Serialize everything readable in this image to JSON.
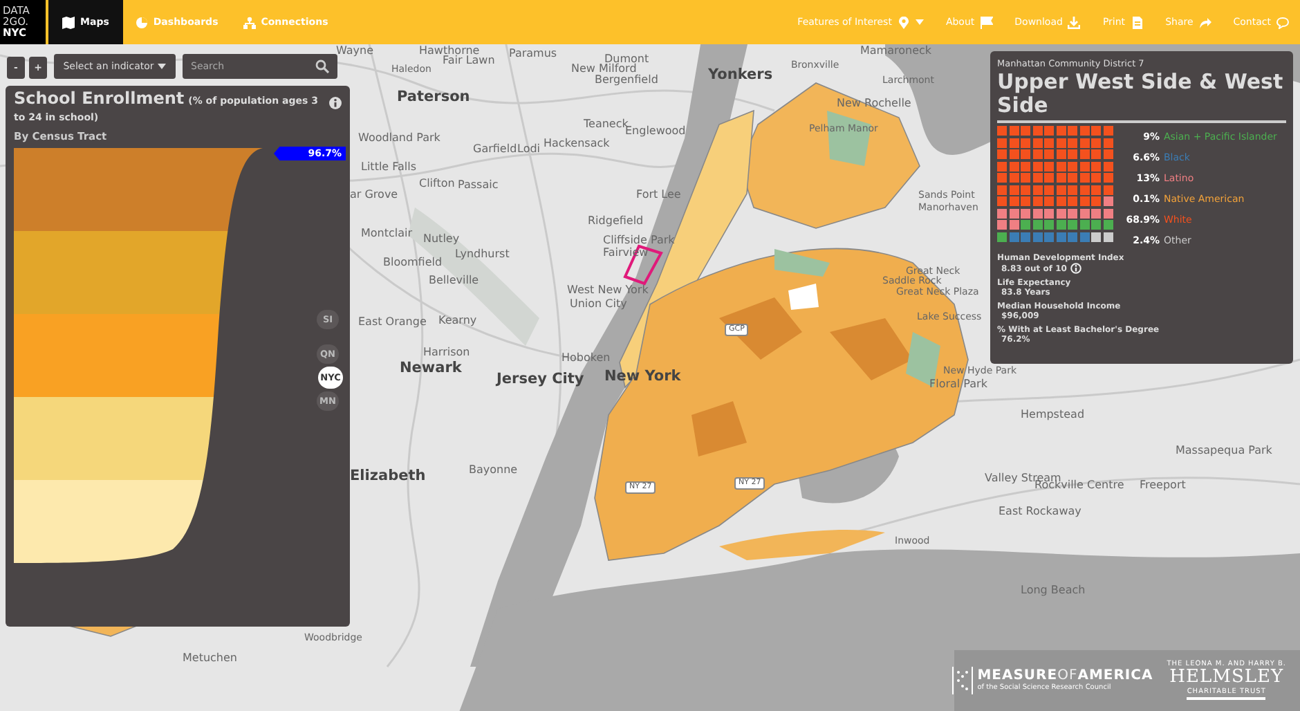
{
  "nav": {
    "logo": [
      "DATA",
      "2GO.",
      "NYC"
    ],
    "items": [
      {
        "label": "Maps",
        "kind": "map",
        "selected": true
      },
      {
        "label": "Dashboards",
        "kind": "pie",
        "selected": false
      },
      {
        "label": "Connections",
        "kind": "network",
        "selected": false
      }
    ],
    "right_items": [
      {
        "label": "Features of Interest",
        "kind": "pin"
      },
      {
        "label": "About",
        "kind": "flag"
      },
      {
        "label": "Download",
        "kind": "download"
      },
      {
        "label": "Print",
        "kind": "document"
      },
      {
        "label": "Share",
        "kind": "share"
      },
      {
        "label": "Contact",
        "kind": "chat"
      }
    ]
  },
  "controls": {
    "zoom_out": "-",
    "zoom_in": "+",
    "indicator_select": "Select an indicator",
    "search": {
      "placeholder": "Search"
    }
  },
  "indicator_panel": {
    "title": "School Enrollment",
    "subtitle": "(% of population ages 3 to 24 in school)",
    "geography": "By Census Tract",
    "value_tag": "96.7%",
    "markers": [
      {
        "label": "SI",
        "selected": false
      },
      {
        "label": "QN",
        "selected": false
      },
      {
        "label": "NYC",
        "selected": true
      },
      {
        "label": "MN",
        "selected": false
      }
    ]
  },
  "map": {
    "places": [
      {
        "name": "Wayne",
        "kind": "town"
      },
      {
        "name": "Hawthorne",
        "kind": "town"
      },
      {
        "name": "Haledon",
        "kind": "small"
      },
      {
        "name": "Fair Lawn",
        "kind": "town"
      },
      {
        "name": "Paramus",
        "kind": "town"
      },
      {
        "name": "Dumont",
        "kind": "town"
      },
      {
        "name": "New Milford",
        "kind": "town"
      },
      {
        "name": "Bergenfield",
        "kind": "town"
      },
      {
        "name": "Yonkers",
        "kind": "city"
      },
      {
        "name": "Bronxville",
        "kind": "small"
      },
      {
        "name": "Mamaroneck",
        "kind": "town"
      },
      {
        "name": "Larchmont",
        "kind": "small"
      },
      {
        "name": "New Rochelle",
        "kind": "town"
      },
      {
        "name": "Pelham Manor",
        "kind": "small"
      },
      {
        "name": "Paterson",
        "kind": "city"
      },
      {
        "name": "Woodland Park",
        "kind": "town"
      },
      {
        "name": "Garfield",
        "kind": "town"
      },
      {
        "name": "Lodi",
        "kind": "town"
      },
      {
        "name": "Teaneck",
        "kind": "town"
      },
      {
        "name": "Hackensack",
        "kind": "town"
      },
      {
        "name": "Englewood",
        "kind": "town"
      },
      {
        "name": "Little Falls",
        "kind": "town"
      },
      {
        "name": "Clifton",
        "kind": "town"
      },
      {
        "name": "Passaic",
        "kind": "town"
      },
      {
        "name": "ar Grove",
        "kind": "town"
      },
      {
        "name": "Fort Lee",
        "kind": "town"
      },
      {
        "name": "Sands Point",
        "kind": "small"
      },
      {
        "name": "Manorhaven",
        "kind": "small"
      },
      {
        "name": "Ridgefield",
        "kind": "town"
      },
      {
        "name": "Montclair",
        "kind": "town"
      },
      {
        "name": "Nutley",
        "kind": "town"
      },
      {
        "name": "Cliffside Park",
        "kind": "town"
      },
      {
        "name": "Fairview",
        "kind": "town"
      },
      {
        "name": "Lyndhurst",
        "kind": "town"
      },
      {
        "name": "Bloomfield",
        "kind": "town"
      },
      {
        "name": "Great Neck",
        "kind": "small"
      },
      {
        "name": "Saddle Rock",
        "kind": "small"
      },
      {
        "name": "Great Neck Plaza",
        "kind": "small"
      },
      {
        "name": "Belleville",
        "kind": "town"
      },
      {
        "name": "West New York",
        "kind": "town"
      },
      {
        "name": "Union City",
        "kind": "town"
      },
      {
        "name": "East Orange",
        "kind": "town"
      },
      {
        "name": "Kearny",
        "kind": "town"
      },
      {
        "name": "Lake Success",
        "kind": "small"
      },
      {
        "name": "Harrison",
        "kind": "town"
      },
      {
        "name": "Hoboken",
        "kind": "town"
      },
      {
        "name": "New Hyde Park",
        "kind": "small"
      },
      {
        "name": "Floral Park",
        "kind": "town"
      },
      {
        "name": "Newark",
        "kind": "city"
      },
      {
        "name": "Jersey City",
        "kind": "city"
      },
      {
        "name": "New York",
        "kind": "city"
      },
      {
        "name": "Hempstead",
        "kind": "town"
      },
      {
        "name": "Elizabeth",
        "kind": "city"
      },
      {
        "name": "Bayonne",
        "kind": "town"
      },
      {
        "name": "Massapequa Park",
        "kind": "town"
      },
      {
        "name": "Valley Stream",
        "kind": "town"
      },
      {
        "name": "Rockville Centre",
        "kind": "town"
      },
      {
        "name": "Freeport",
        "kind": "town"
      },
      {
        "name": "East Rockaway",
        "kind": "town"
      },
      {
        "name": "Inwood",
        "kind": "small"
      },
      {
        "name": "Long Beach",
        "kind": "town"
      },
      {
        "name": "Metuchen",
        "kind": "town"
      },
      {
        "name": "Woodbridge",
        "kind": "small"
      }
    ],
    "shields": [
      "GCP",
      "NY 27",
      "NY 27"
    ]
  },
  "district_panel": {
    "district": "Manhattan Community District 7",
    "name": "Upper West Side & West Side",
    "demographics": [
      {
        "percent": "9%",
        "label": "Asian + Pacific Islander",
        "color": "#4caf50"
      },
      {
        "percent": "6.6%",
        "label": "Black",
        "color": "#3b7db5"
      },
      {
        "percent": "13%",
        "label": "Latino",
        "color": "#f07f83"
      },
      {
        "percent": "0.1%",
        "label": "Native American",
        "color": "#f2a23a"
      },
      {
        "percent": "68.9%",
        "label": "White",
        "color": "#f4511e"
      },
      {
        "percent": "2.4%",
        "label": "Other",
        "color": "#cccccc"
      }
    ],
    "stats": [
      {
        "label": "Human Development Index",
        "value": "8.83 out of 10",
        "info": true
      },
      {
        "label": "Life Expectancy",
        "value": "83.8 Years",
        "info": false
      },
      {
        "label": "Median Household Income",
        "value": "$96,009",
        "info": false
      },
      {
        "label": "% With at Least Bachelor's Degree",
        "value": "76.2%",
        "info": false
      }
    ]
  },
  "sponsors": {
    "measure": {
      "name_a": "MEASURE",
      "name_b": "OF",
      "name_c": "AMERICA",
      "tagline": "of the Social Science Research Council"
    },
    "helmsley": {
      "top": "THE LEONA M. AND HARRY B.",
      "name": "HELMSLEY",
      "bottom": "CHARITABLE TRUST"
    }
  }
}
